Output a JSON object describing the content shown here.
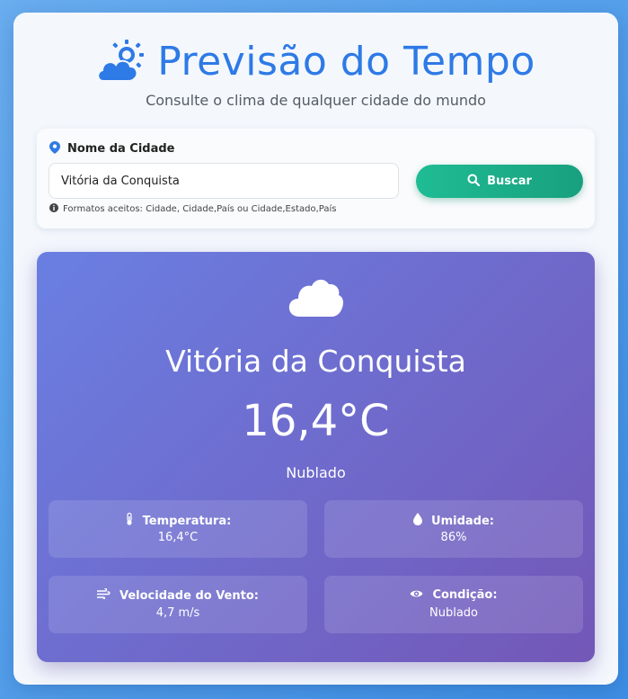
{
  "header": {
    "title": "Previsão do Tempo",
    "subtitle": "Consulte o clima de qualquer cidade do mundo",
    "icon": "cloud-sun-icon"
  },
  "search": {
    "label": "Nome da Cidade",
    "value": "Vitória da Conquista",
    "button_label": "Buscar",
    "hint": "Formatos aceitos: Cidade, Cidade,País ou Cidade,Estado,País"
  },
  "weather": {
    "icon": "cloud-icon",
    "city": "Vitória da Conquista",
    "temperature": "16,4°C",
    "condition": "Nublado",
    "details": {
      "temperature": {
        "label": "Temperatura:",
        "value": "16,4°C",
        "icon": "thermometer-icon"
      },
      "humidity": {
        "label": "Umidade:",
        "value": "86%",
        "icon": "droplet-icon"
      },
      "wind": {
        "label": "Velocidade do Vento:",
        "value": "4,7 m/s",
        "icon": "wind-icon"
      },
      "condition": {
        "label": "Condição:",
        "value": "Nublado",
        "icon": "eye-icon"
      }
    }
  },
  "colors": {
    "accent": "#2e7ae6",
    "button": "#1fbc94",
    "card_gradient_start": "#6a7fe2",
    "card_gradient_end": "#7357b7"
  }
}
